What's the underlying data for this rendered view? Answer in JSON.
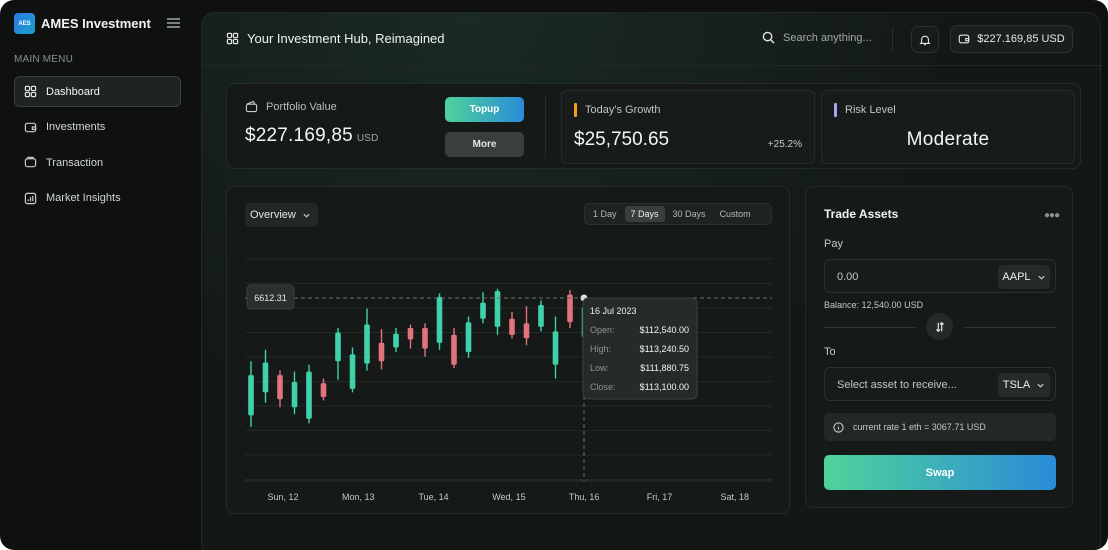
{
  "app": {
    "logo_text": "AES",
    "name": "AMES Investment"
  },
  "sidebar": {
    "section_label": "MAIN MENU",
    "items": [
      {
        "label": "Dashboard",
        "icon": "grid-icon",
        "active": true
      },
      {
        "label": "Investments",
        "icon": "wallet-icon",
        "active": false
      },
      {
        "label": "Transaction",
        "icon": "layers-icon",
        "active": false
      },
      {
        "label": "Market Insights",
        "icon": "bar-chart-icon",
        "active": false
      }
    ]
  },
  "header": {
    "title": "Your Investment Hub, Reimagined",
    "search_placeholder": "Search anything...",
    "balance": "$227.169,85 USD"
  },
  "stats": {
    "portfolio_label": "Portfolio Value",
    "portfolio_value": "$227.169,85",
    "portfolio_currency": "USD",
    "topup_label": "Topup",
    "more_label": "More",
    "growth_label": "Today's Growth",
    "growth_value": "$25,750.65",
    "growth_percent": "+25.2%",
    "risk_label": "Risk Level",
    "risk_value": "Moderate",
    "colors": {
      "growth_accent": "#f0a020",
      "risk_accent": "#a8a4f0"
    }
  },
  "chart_panel": {
    "view_select": "Overview",
    "ranges": [
      "1 Day",
      "7 Days",
      "30 Days",
      "Custom"
    ],
    "active_range": "7 Days",
    "crosshair_value": "6612.31",
    "tooltip": {
      "date": "16 Jul 2023",
      "rows": [
        {
          "label": "Open:",
          "value": "$112,540.00"
        },
        {
          "label": "High:",
          "value": "$113,240.50"
        },
        {
          "label": "Low:",
          "value": "$111,880.75"
        },
        {
          "label": "Close:",
          "value": "$113,100.00"
        }
      ]
    }
  },
  "chart_data": {
    "type": "candlestick",
    "x_labels": [
      "Sun, 12",
      "Mon, 13",
      "Tue, 14",
      "Wed, 15",
      "Thu, 16",
      "Fri, 17",
      "Sat, 18"
    ],
    "colors": {
      "up": "#3fd1a9",
      "down": "#e0737b"
    },
    "candles": [
      {
        "open": 31,
        "close": 66,
        "high": 78,
        "low": 21,
        "dir": "up"
      },
      {
        "open": 51,
        "close": 77,
        "high": 88,
        "low": 42,
        "dir": "up"
      },
      {
        "open": 66,
        "close": 45,
        "high": 70,
        "low": 38,
        "dir": "down"
      },
      {
        "open": 38,
        "close": 60,
        "high": 69,
        "low": 32,
        "dir": "up"
      },
      {
        "open": 28,
        "close": 69,
        "high": 75,
        "low": 24,
        "dir": "up"
      },
      {
        "open": 59,
        "close": 47,
        "high": 63,
        "low": 44,
        "dir": "down"
      },
      {
        "open": 78,
        "close": 103,
        "high": 107,
        "low": 62,
        "dir": "up"
      },
      {
        "open": 54,
        "close": 84,
        "high": 90,
        "low": 51,
        "dir": "up"
      },
      {
        "open": 76,
        "close": 110,
        "high": 124,
        "low": 70,
        "dir": "up"
      },
      {
        "open": 94,
        "close": 78,
        "high": 106,
        "low": 71,
        "dir": "down"
      },
      {
        "open": 90,
        "close": 102,
        "high": 107,
        "low": 86,
        "dir": "up"
      },
      {
        "open": 107,
        "close": 97,
        "high": 110,
        "low": 89,
        "dir": "down"
      },
      {
        "open": 107,
        "close": 89,
        "high": 111,
        "low": 82,
        "dir": "down"
      },
      {
        "open": 94,
        "close": 134,
        "high": 137,
        "low": 88,
        "dir": "up"
      },
      {
        "open": 101,
        "close": 75,
        "high": 107,
        "low": 72,
        "dir": "down"
      },
      {
        "open": 86,
        "close": 112,
        "high": 117,
        "low": 81,
        "dir": "up"
      },
      {
        "open": 115,
        "close": 129,
        "high": 138,
        "low": 111,
        "dir": "up"
      },
      {
        "open": 139,
        "close": 108,
        "high": 141,
        "low": 101,
        "dir": "up"
      },
      {
        "open": 115,
        "close": 101,
        "high": 121,
        "low": 98,
        "dir": "down"
      },
      {
        "open": 111,
        "close": 98,
        "high": 126,
        "low": 92,
        "dir": "down"
      },
      {
        "open": 108,
        "close": 127,
        "high": 131,
        "low": 104,
        "dir": "up"
      },
      {
        "open": 104,
        "close": 75,
        "high": 117,
        "low": 63,
        "dir": "up"
      },
      {
        "open": 136,
        "close": 112,
        "high": 140,
        "low": 107,
        "dir": "down"
      },
      {
        "open": 125,
        "close": 99,
        "high": 136,
        "low": 94,
        "dir": "up"
      },
      {
        "open": 109,
        "close": 96,
        "high": 116,
        "low": 90,
        "dir": "down"
      },
      {
        "open": 104,
        "close": 84,
        "high": 106,
        "low": 80,
        "dir": "down"
      },
      {
        "open": 83,
        "close": 67,
        "high": 89,
        "low": 61,
        "dir": "down"
      }
    ]
  },
  "trade": {
    "title": "Trade Assets",
    "pay_label": "Pay",
    "pay_amount": "0.00",
    "pay_asset": "AAPL",
    "balance_text": "Balance: 12,540.00 USD",
    "to_label": "To",
    "receive_placeholder": "Select asset to receive...",
    "receive_asset": "TSLA",
    "rate_text": "current rate 1 eth = 3067.71 USD",
    "swap_label": "Swap"
  }
}
